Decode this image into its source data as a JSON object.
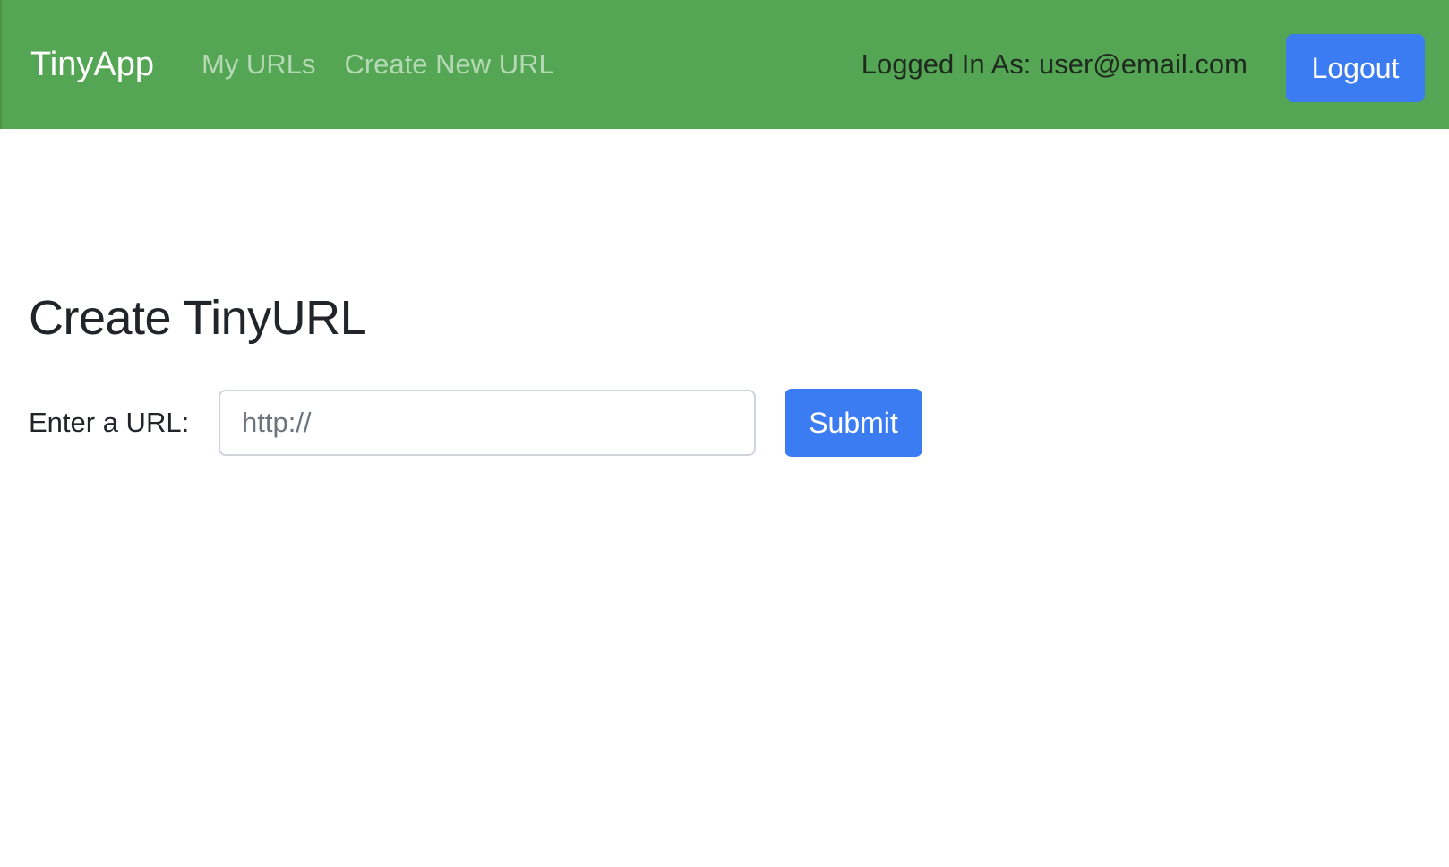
{
  "navbar": {
    "brand": "TinyApp",
    "links": [
      {
        "label": "My URLs"
      },
      {
        "label": "Create New URL"
      }
    ],
    "login_status": "Logged In As: user@email.com",
    "logout_label": "Logout",
    "background_color": "#54a654",
    "button_color": "#3b7cf3"
  },
  "main": {
    "title": "Create TinyURL",
    "form": {
      "label": "Enter a URL:",
      "input_value": "",
      "input_placeholder": "http://",
      "submit_label": "Submit"
    }
  }
}
